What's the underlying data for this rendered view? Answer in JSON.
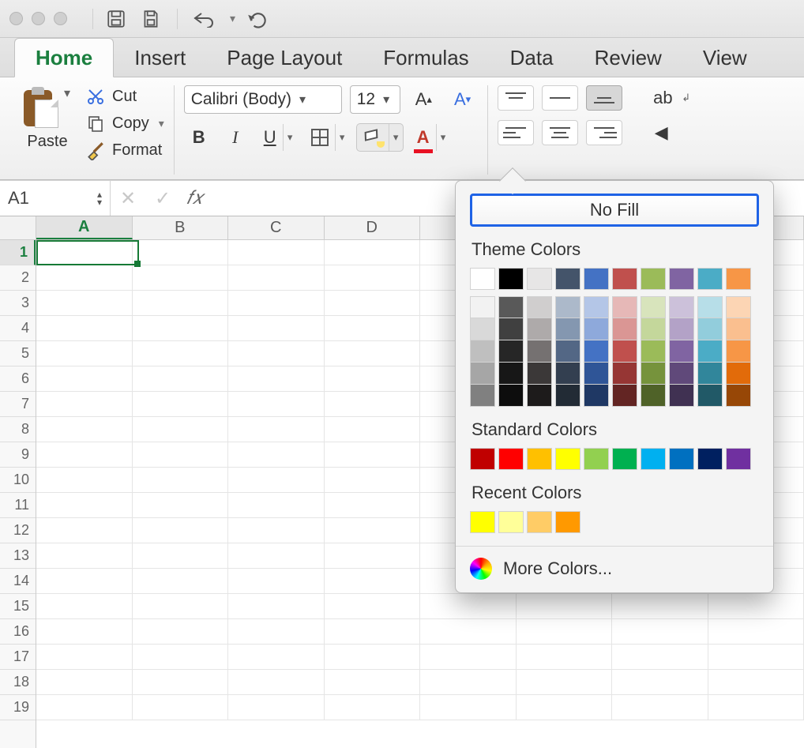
{
  "tabs": [
    "Home",
    "Insert",
    "Page Layout",
    "Formulas",
    "Data",
    "Review",
    "View"
  ],
  "active_tab": "Home",
  "clipboard": {
    "paste": "Paste",
    "cut": "Cut",
    "copy": "Copy",
    "format": "Format"
  },
  "font": {
    "name": "Calibri (Body)",
    "size": "12"
  },
  "formula_bar": {
    "cell_ref": "A1",
    "fx": "𝑓𝑥",
    "value": ""
  },
  "columns": [
    "A",
    "B",
    "C",
    "D"
  ],
  "rows": [
    "1",
    "2",
    "3",
    "4",
    "5",
    "6",
    "7",
    "8",
    "9",
    "10",
    "11",
    "12",
    "13",
    "14",
    "15",
    "16",
    "17",
    "18",
    "19"
  ],
  "selected_cell": "A1",
  "color_picker": {
    "no_fill": "No Fill",
    "theme_title": "Theme Colors",
    "theme_main": [
      "#FFFFFF",
      "#000000",
      "#E7E6E6",
      "#44546A",
      "#4472C4",
      "#C0504D",
      "#9BBB59",
      "#8064A2",
      "#4BACC6",
      "#F79646"
    ],
    "theme_shades": [
      [
        "#F2F2F2",
        "#D9D9D9",
        "#BFBFBF",
        "#A6A6A6",
        "#808080"
      ],
      [
        "#595959",
        "#404040",
        "#262626",
        "#171717",
        "#0D0D0D"
      ],
      [
        "#D0CECE",
        "#AEAAAA",
        "#757171",
        "#3B3838",
        "#1D1B1B"
      ],
      [
        "#ACB9CA",
        "#8497B0",
        "#536785",
        "#333F50",
        "#222B35"
      ],
      [
        "#B4C6E7",
        "#8EA9DB",
        "#4472C4",
        "#2F5597",
        "#1F3864"
      ],
      [
        "#E6B8B7",
        "#DA9694",
        "#C0504D",
        "#963634",
        "#632523"
      ],
      [
        "#D8E4BC",
        "#C4D79B",
        "#9BBB59",
        "#76933C",
        "#4F6228"
      ],
      [
        "#CCC1DA",
        "#B3A2C7",
        "#8064A2",
        "#60497A",
        "#403152"
      ],
      [
        "#B7DEE8",
        "#92CDDC",
        "#4BACC6",
        "#31869B",
        "#215967"
      ],
      [
        "#FCD5B4",
        "#FABF8F",
        "#F79646",
        "#E26B0A",
        "#974706"
      ]
    ],
    "standard_title": "Standard Colors",
    "standard": [
      "#C00000",
      "#FF0000",
      "#FFC000",
      "#FFFF00",
      "#92D050",
      "#00B050",
      "#00B0F0",
      "#0070C0",
      "#002060",
      "#7030A0"
    ],
    "recent_title": "Recent Colors",
    "recent": [
      "#FFFF00",
      "#FFFF99",
      "#FFCC66",
      "#FF9900"
    ],
    "more": "More Colors..."
  }
}
